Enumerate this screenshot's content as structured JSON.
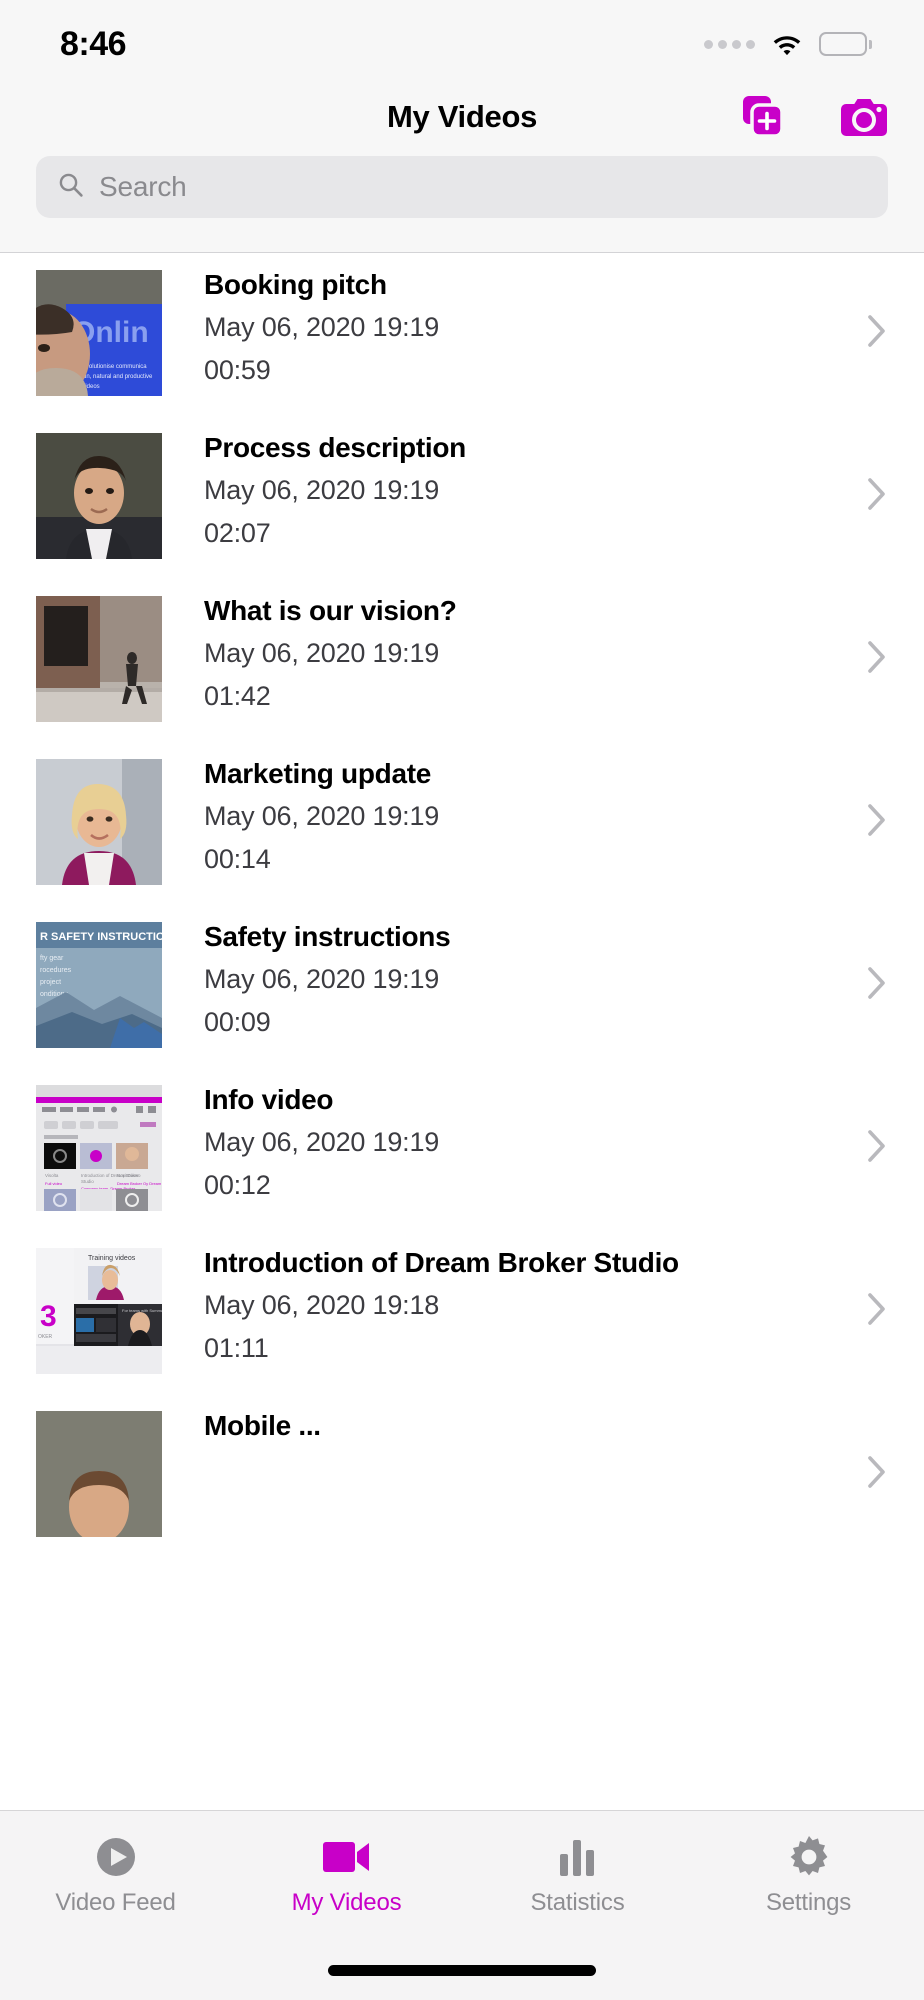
{
  "status_bar": {
    "time": "8:46",
    "signal_icon": "signal-dots-icon",
    "wifi_icon": "wifi-icon",
    "battery_icon": "battery-full-icon"
  },
  "nav_bar": {
    "title": "My Videos",
    "actions": [
      {
        "name": "add-video-button",
        "icon": "add-stacked-squares-icon",
        "label": "Add video"
      },
      {
        "name": "record-camera-button",
        "icon": "camera-icon",
        "label": "Record"
      }
    ]
  },
  "search": {
    "placeholder": "Search",
    "value": "",
    "icon": "search-icon"
  },
  "videos": [
    {
      "title": "Booking pitch",
      "date": "May 06, 2020 19:19",
      "duration": "00:59",
      "thumb": "man-presenting-online-video-screen"
    },
    {
      "title": "Process description",
      "date": "May 06, 2020 19:19",
      "duration": "02:07",
      "thumb": "man-in-suit-portrait"
    },
    {
      "title": "What is our vision?",
      "date": "May 06, 2020 19:19",
      "duration": "01:42",
      "thumb": "street-with-person-walking"
    },
    {
      "title": "Marketing update",
      "date": "May 06, 2020 19:19",
      "duration": "00:14",
      "thumb": "woman-in-magenta-blazer"
    },
    {
      "title": "Safety instructions",
      "date": "May 06, 2020 19:19",
      "duration": "00:09",
      "thumb": "safety-instructions-slide-mountains"
    },
    {
      "title": "Info video",
      "date": "May 06, 2020 19:19",
      "duration": "00:12",
      "thumb": "web-dashboard-screenshot"
    },
    {
      "title": "Introduction of Dream Broker Studio",
      "date": "May 06, 2020 19:18",
      "duration": "01:11",
      "thumb": "training-videos-collage"
    },
    {
      "title": "Mobile ...",
      "date": "",
      "duration": "",
      "thumb": "person-head-partial"
    }
  ],
  "tab_bar": {
    "active_index": 1,
    "tabs": [
      {
        "label": "Video Feed",
        "icon": "play-circle-icon"
      },
      {
        "label": "My Videos",
        "icon": "camcorder-icon"
      },
      {
        "label": "Statistics",
        "icon": "bar-chart-icon"
      },
      {
        "label": "Settings",
        "icon": "gear-icon"
      }
    ]
  },
  "colors": {
    "accent": "#c800c8",
    "text_primary": "#000000",
    "text_secondary": "#3c3c41",
    "text_muted": "#8e8e92",
    "chrome_bg": "#f7f7f7",
    "search_bg": "#e7e7e9"
  }
}
